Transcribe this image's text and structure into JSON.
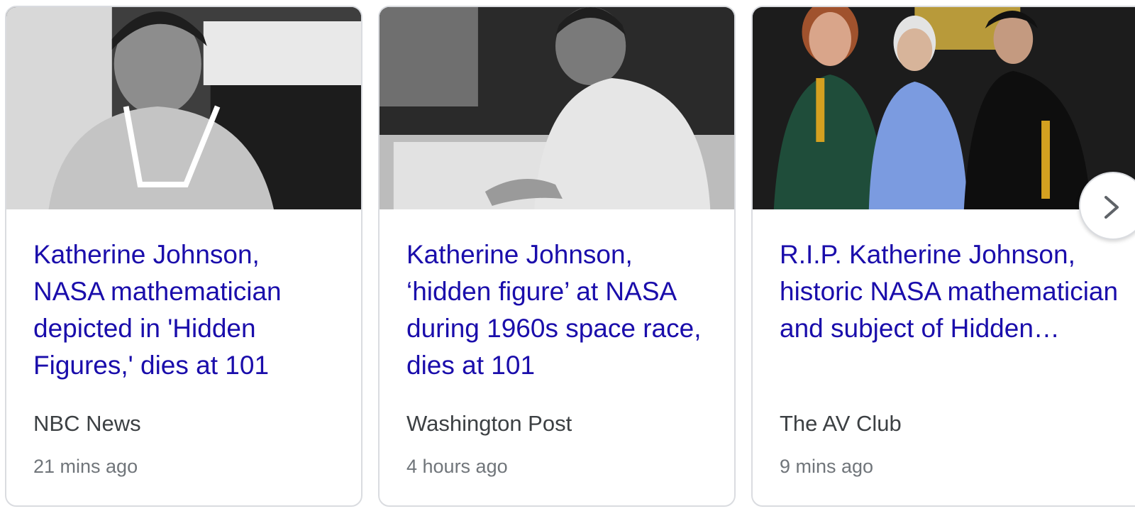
{
  "cards": [
    {
      "headline": "Katherine Johnson, NASA mathematician depicted in 'Hidden Figures,' dies at 101",
      "source": "NBC News",
      "time": "21 mins ago",
      "image": "black-and-white photo of woman smiling at desk"
    },
    {
      "headline": "Katherine Johnson, ‘hidden figure’ at NASA during 1960s space race, dies at 101",
      "source": "Washington Post",
      "time": "4 hours ago",
      "image": "black-and-white photo of woman writing at desk"
    },
    {
      "headline": "R.I.P. Katherine Johnson, historic NASA mathematician and subject of Hidden…",
      "source": "The AV Club",
      "time": "9 mins ago",
      "image": "color photo of three people with award statuettes"
    }
  ],
  "next_button": {
    "icon": "chevron-right-icon"
  }
}
